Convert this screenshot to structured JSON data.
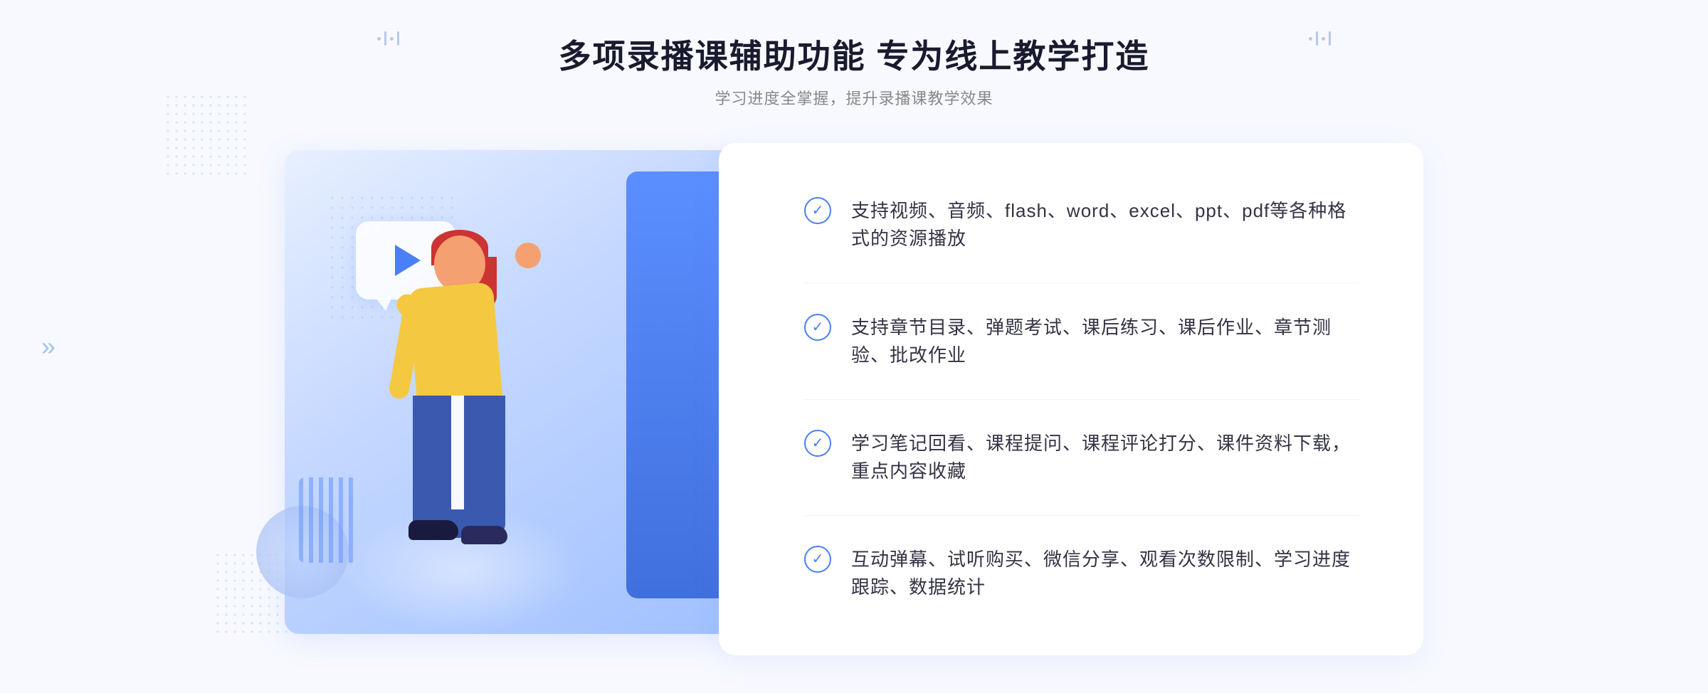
{
  "page": {
    "background": "#f4f6ff"
  },
  "header": {
    "title": "多项录播课辅助功能 专为线上教学打造",
    "subtitle": "学习进度全掌握，提升录播课教学效果",
    "decorator_left": "::  ::",
    "decorator_right": "::  ::"
  },
  "features": [
    {
      "id": "feature-1",
      "text": "支持视频、音频、flash、word、excel、ppt、pdf等各种格式的资源播放"
    },
    {
      "id": "feature-2",
      "text": "支持章节目录、弹题考试、课后练习、课后作业、章节测验、批改作业"
    },
    {
      "id": "feature-3",
      "text": "学习笔记回看、课程提问、课程评论打分、课件资料下载，重点内容收藏"
    },
    {
      "id": "feature-4",
      "text": "互动弹幕、试听购买、微信分享、观看次数限制、学习进度跟踪、数据统计"
    }
  ],
  "icons": {
    "check": "✓",
    "play": "▶",
    "chevron": "»"
  }
}
